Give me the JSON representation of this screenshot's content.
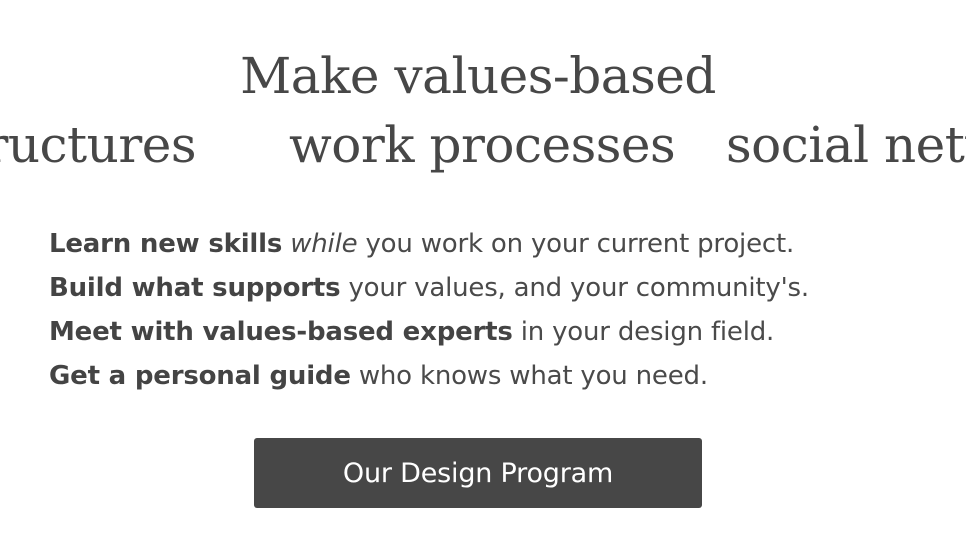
{
  "hero": {
    "title": "Make values-based",
    "carousel": [
      "ructures",
      "work processes",
      "social netw"
    ]
  },
  "benefits": [
    {
      "bold": "Learn new skills",
      "italic": "while",
      "rest": "you work on your current project."
    },
    {
      "bold": "Build what supports",
      "italic": "",
      "rest": "your values, and your community's."
    },
    {
      "bold": "Meet with values-based experts",
      "italic": "",
      "rest": "in your design field."
    },
    {
      "bold": "Get a personal guide",
      "italic": "",
      "rest": "who knows what you need."
    }
  ],
  "cta": {
    "label": "Our Design Program"
  }
}
